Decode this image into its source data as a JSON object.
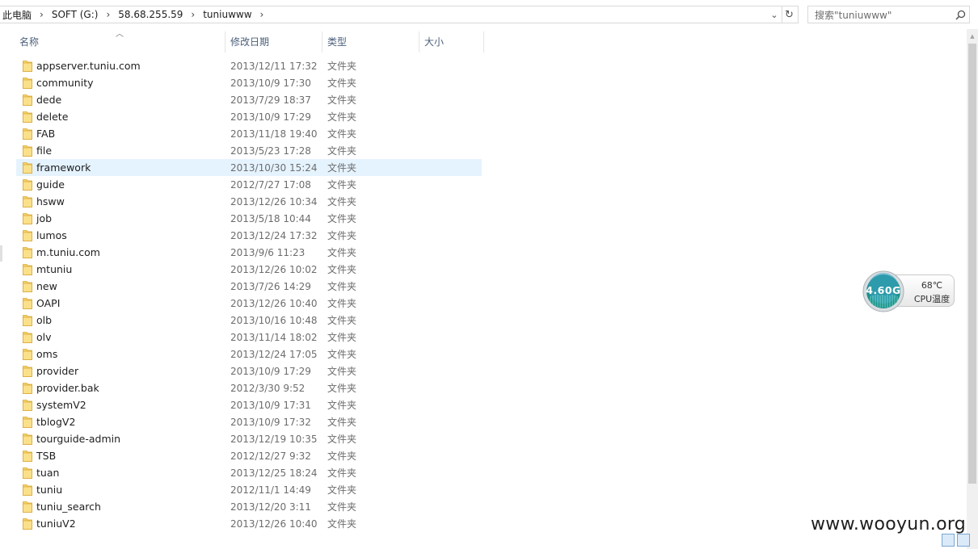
{
  "address": {
    "crumbs": [
      "此电脑",
      "SOFT (G:)",
      "58.68.255.59",
      "tuniuwww"
    ]
  },
  "search": {
    "placeholder": "搜索\"tuniuwww\""
  },
  "columns": {
    "name": "名称",
    "date": "修改日期",
    "type": "类型",
    "size": "大小"
  },
  "files": [
    {
      "name": "appserver.tuniu.com",
      "date": "2013/12/11 17:32",
      "type": "文件夹"
    },
    {
      "name": "community",
      "date": "2013/10/9 17:30",
      "type": "文件夹"
    },
    {
      "name": "dede",
      "date": "2013/7/29 18:37",
      "type": "文件夹"
    },
    {
      "name": "delete",
      "date": "2013/10/9 17:29",
      "type": "文件夹"
    },
    {
      "name": "FAB",
      "date": "2013/11/18 19:40",
      "type": "文件夹"
    },
    {
      "name": "file",
      "date": "2013/5/23 17:28",
      "type": "文件夹"
    },
    {
      "name": "framework",
      "date": "2013/10/30 15:24",
      "type": "文件夹"
    },
    {
      "name": "guide",
      "date": "2012/7/27 17:08",
      "type": "文件夹"
    },
    {
      "name": "hsww",
      "date": "2013/12/26 10:34",
      "type": "文件夹"
    },
    {
      "name": "job",
      "date": "2013/5/18 10:44",
      "type": "文件夹"
    },
    {
      "name": "lumos",
      "date": "2013/12/24 17:32",
      "type": "文件夹"
    },
    {
      "name": "m.tuniu.com",
      "date": "2013/9/6 11:23",
      "type": "文件夹"
    },
    {
      "name": "mtuniu",
      "date": "2013/12/26 10:02",
      "type": "文件夹"
    },
    {
      "name": "new",
      "date": "2013/7/26 14:29",
      "type": "文件夹"
    },
    {
      "name": "OAPI",
      "date": "2013/12/26 10:40",
      "type": "文件夹"
    },
    {
      "name": "olb",
      "date": "2013/10/16 10:48",
      "type": "文件夹"
    },
    {
      "name": "olv",
      "date": "2013/11/14 18:02",
      "type": "文件夹"
    },
    {
      "name": "oms",
      "date": "2013/12/24 17:05",
      "type": "文件夹"
    },
    {
      "name": "provider",
      "date": "2013/10/9 17:29",
      "type": "文件夹"
    },
    {
      "name": "provider.bak",
      "date": "2012/3/30 9:52",
      "type": "文件夹"
    },
    {
      "name": "systemV2",
      "date": "2013/10/9 17:31",
      "type": "文件夹"
    },
    {
      "name": "tblogV2",
      "date": "2013/10/9 17:32",
      "type": "文件夹"
    },
    {
      "name": "tourguide-admin",
      "date": "2013/12/19 10:35",
      "type": "文件夹"
    },
    {
      "name": "TSB",
      "date": "2012/12/27 9:32",
      "type": "文件夹"
    },
    {
      "name": "tuan",
      "date": "2013/12/25 18:24",
      "type": "文件夹"
    },
    {
      "name": "tuniu",
      "date": "2012/11/1 14:49",
      "type": "文件夹"
    },
    {
      "name": "tuniu_search",
      "date": "2013/12/20 3:11",
      "type": "文件夹"
    },
    {
      "name": "tuniuV2",
      "date": "2013/12/26 10:40",
      "type": "文件夹"
    }
  ],
  "hovered_file": "framework",
  "cpu_widget": {
    "frequency": "4.60G",
    "temperature": "68℃",
    "label": "CPU温度"
  },
  "watermark": "www.wooyun.org",
  "colors": {
    "folder": "#f6d366",
    "hover": "#e5f3ff",
    "gauge": "#1e8f8a"
  }
}
